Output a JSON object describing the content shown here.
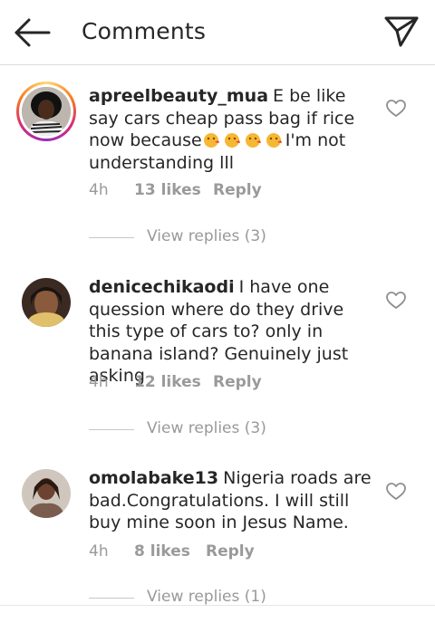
{
  "header": {
    "title": "Comments"
  },
  "comments": [
    {
      "username": "apreelbeauty_mua",
      "text_before": "E be like say cars cheap pass bag if rice now because",
      "emoji_count": 4,
      "text_after": "I'm not understanding lll",
      "time": "4h",
      "likes": "13 likes",
      "reply": "Reply",
      "view_replies": "View replies (3)"
    },
    {
      "username": "denicechikaodi",
      "text": "I have one quession where do they drive this type of cars to? only in banana island? Genuinely just asking",
      "time": "4h",
      "likes": "12 likes",
      "reply": "Reply",
      "view_replies": "View replies (3)"
    },
    {
      "username": "omolabake13",
      "text": "Nigeria roads are bad.Congratulations. I will still buy mine soon in Jesus Name.",
      "time": "4h",
      "likes": "8 likes",
      "reply": "Reply",
      "view_replies": "View replies (1)"
    }
  ],
  "icons": {
    "back": "back-arrow-icon",
    "send": "paper-plane-icon",
    "like": "heart-outline-icon",
    "emoji": "kissing-face-emoji"
  },
  "colors": {
    "text": "#262626",
    "muted": "#8e8e8e",
    "divider": "#dbdbdb",
    "emoji": "#f7b733"
  }
}
